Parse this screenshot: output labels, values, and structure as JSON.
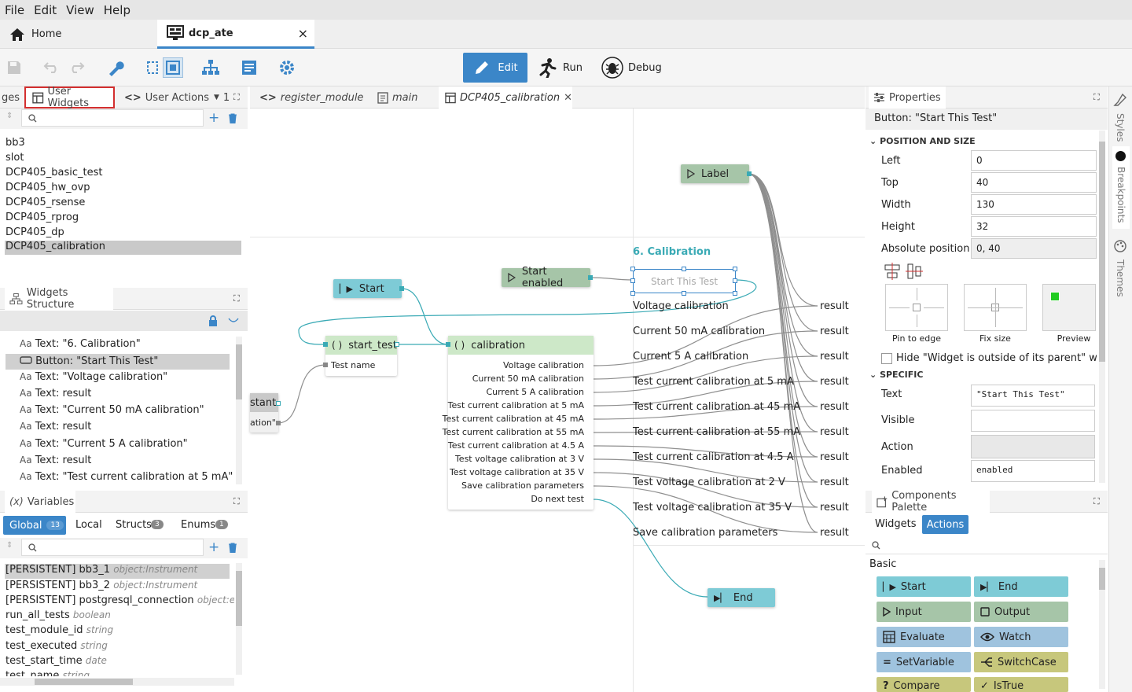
{
  "menu": [
    "File",
    "Edit",
    "View",
    "Help"
  ],
  "tabs": {
    "home": "Home",
    "project": "dcp_ate",
    "close": "×"
  },
  "modes": {
    "edit": "Edit",
    "run": "Run",
    "debug": "Debug"
  },
  "left_tabs": {
    "pages_partial": "ges",
    "user_widgets": "User Widgets",
    "user_actions": "User Actions",
    "more": "1"
  },
  "user_widgets_list": [
    "bb3",
    "slot",
    "DCP405_basic_test",
    "DCP405_hw_ovp",
    "DCP405_rsense",
    "DCP405_rprog",
    "DCP405_dp",
    "DCP405_calibration"
  ],
  "structure": {
    "title": "Widgets Structure",
    "items": [
      "Text: \"6. Calibration\"",
      "Button: \"Start This Test\"",
      "Text: \"Voltage calibration\"",
      "Text: result",
      "Text: \"Current 50 mA calibration\"",
      "Text: result",
      "Text: \"Current 5 A calibration\"",
      "Text: result",
      "Text: \"Test current calibration at 5 mA\""
    ]
  },
  "variables": {
    "title": "Variables",
    "tabs": {
      "global": "Global",
      "global_count": "13",
      "local": "Local",
      "structs": "Structs",
      "structs_count": "3",
      "enums": "Enums",
      "enums_count": "1"
    },
    "rows": [
      {
        "name": "[PERSISTENT] bb3_1",
        "type": "object:Instrument"
      },
      {
        "name": "[PERSISTENT] bb3_2",
        "type": "object:Instrument"
      },
      {
        "name": "[PERSISTENT] postgresql_connection",
        "type": "object:eez-flo"
      },
      {
        "name": "run_all_tests",
        "type": "boolean"
      },
      {
        "name": "test_module_id",
        "type": "string"
      },
      {
        "name": "test_executed",
        "type": "string"
      },
      {
        "name": "test_start_time",
        "type": "date"
      },
      {
        "name": "test_name",
        "type": "string"
      }
    ]
  },
  "editor_tabs": {
    "register_module": "register_module",
    "main": "main",
    "calibration": "DCP405_calibration"
  },
  "canvas": {
    "label_node": "Label",
    "start_enabled_node": "Start enabled",
    "start_node": "Start",
    "start_test_node": "start_test",
    "start_test_port": "Test name",
    "constant_partial": "stant",
    "constant_value_partial": "ation\"",
    "calibration_node": "calibration",
    "calibration_ports": [
      "Voltage calibration",
      "Current 50 mA calibration",
      "Current 5 A calibration",
      "Test current calibration at 5 mA",
      "Test current calibration at 45 mA",
      "Test current calibration at 55 mA",
      "Test current calibration at 4.5 A",
      "Test voltage calibration at 3 V",
      "Test voltage calibration at 35 V",
      "Save calibration parameters",
      "Do next test"
    ],
    "end_node": "End",
    "page_title": "6. Calibration",
    "page_button": "Start This Test",
    "page_texts": [
      "Voltage calibration",
      "Current 50 mA calibration",
      "Current 5 A calibration",
      "Test current calibration at 5 mA",
      "Test current calibration at 45 mA",
      "Test current calibration at 55 mA",
      "Test current calibration at 4.5 A",
      "Test voltage calibration at 2 V",
      "Test voltage calibration at 35 V",
      "Save calibration parameters"
    ],
    "result_label": "result"
  },
  "properties": {
    "title": "Properties",
    "selected": "Button: \"Start This Test\"",
    "section_position": "POSITION AND SIZE",
    "left_label": "Left",
    "left_value": "0",
    "top_label": "Top",
    "top_value": "40",
    "width_label": "Width",
    "width_value": "130",
    "height_label": "Height",
    "height_value": "32",
    "abs_label": "Absolute position",
    "abs_value": "0, 40",
    "pin_to_edge": "Pin to edge",
    "fix_size": "Fix size",
    "preview": "Preview",
    "hide_warning": "Hide \"Widget is outside of its parent\" warnir",
    "section_specific": "SPECIFIC",
    "text_label": "Text",
    "text_value": "\"Start This Test\"",
    "visible_label": "Visible",
    "action_label": "Action",
    "enabled_label": "Enabled",
    "enabled_value": "enabled"
  },
  "palette": {
    "title": "Components Palette",
    "tab_widgets": "Widgets",
    "tab_actions": "Actions",
    "group": "Basic",
    "items": [
      "Start",
      "End",
      "Input",
      "Output",
      "Evaluate",
      "Watch",
      "SetVariable",
      "SwitchCase",
      "Compare",
      "IsTrue"
    ]
  },
  "side_tabs": [
    "Styles",
    "Breakpoints",
    "Themes"
  ],
  "colors": {
    "accent": "#3b86c8",
    "highlight_box": "#d32f2f",
    "teal_node": "#7ecbd6",
    "green_node": "#cde8c8",
    "sage_node": "#a6c5a8",
    "palette_blue": "#9fc3de",
    "palette_olive": "#c7c77c"
  }
}
